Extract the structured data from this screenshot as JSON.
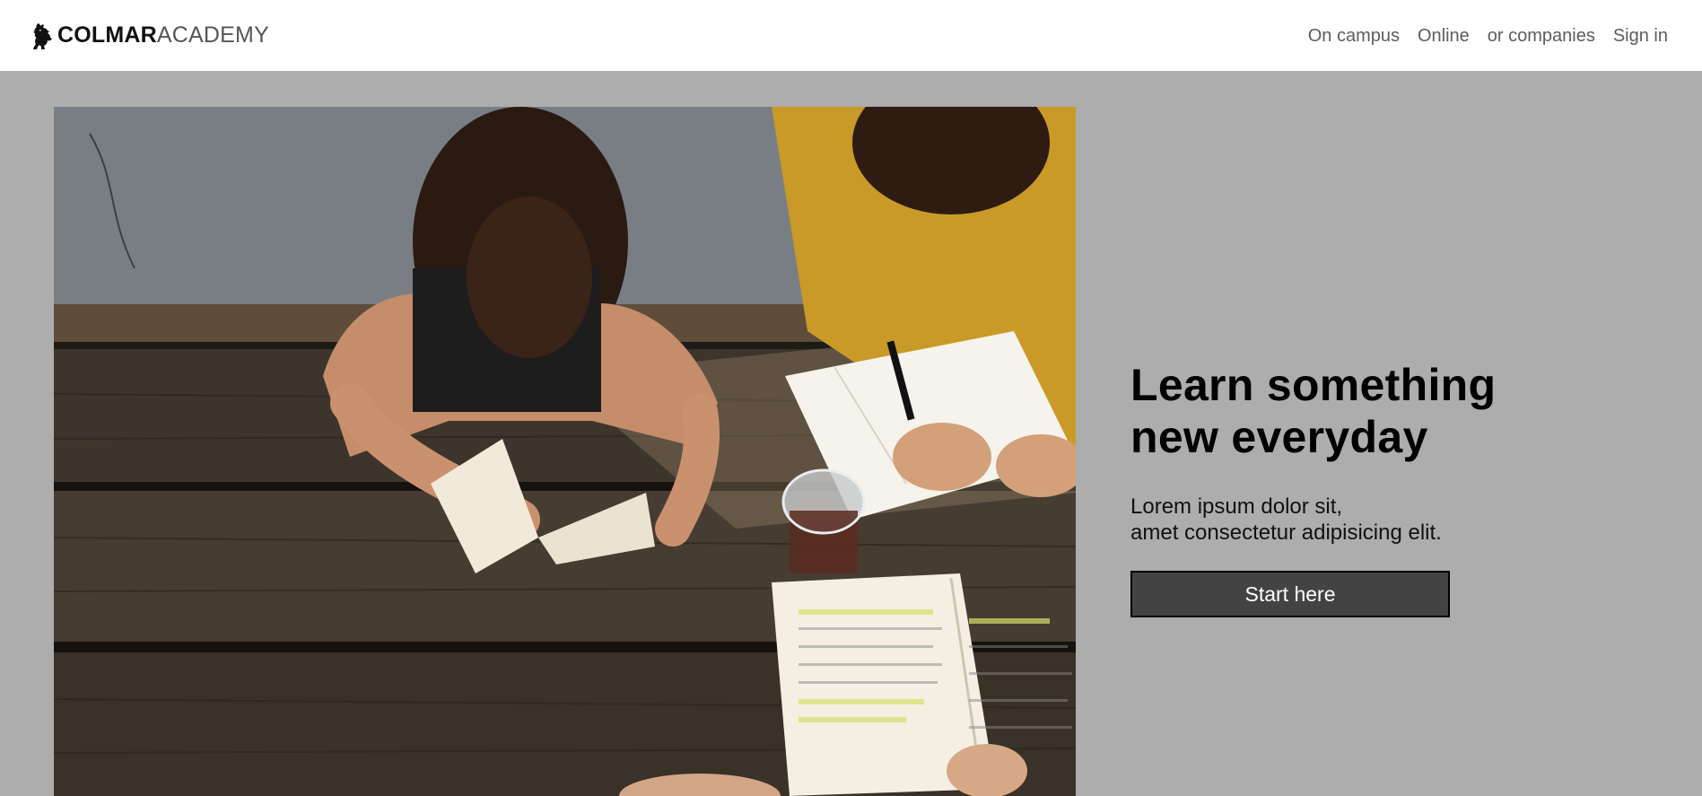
{
  "header": {
    "logo": {
      "bold": "COLMAR",
      "light": "ACADEMY",
      "icon": "lion-rampant-icon"
    },
    "nav": [
      {
        "label": "On campus"
      },
      {
        "label": "Online"
      },
      {
        "label": "or companies"
      },
      {
        "label": "Sign in"
      }
    ]
  },
  "hero": {
    "image_alt": "Students reading and writing at a wooden picnic table",
    "title_line1": "Learn something",
    "title_line2": "new everyday",
    "subtitle_line1": "Lorem ipsum dolor sit,",
    "subtitle_line2": "amet consectetur adipisicing elit.",
    "cta_label": "Start here"
  },
  "colors": {
    "page_background": "#adadad",
    "header_background": "#ffffff",
    "cta_background": "#434343",
    "cta_text": "#ffffff"
  }
}
